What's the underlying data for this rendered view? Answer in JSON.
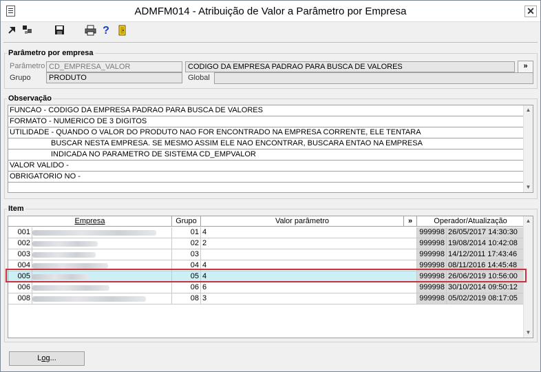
{
  "window": {
    "title": "ADMFM014 - Atribuição de Valor a Parâmetro por Empresa",
    "close_label": "✕"
  },
  "toolbar": {
    "icons": [
      "arrow-icon",
      "arrange-icon",
      "save-icon",
      "print-icon",
      "help-icon",
      "exit-icon"
    ]
  },
  "parametro": {
    "legend": "Parâmetro por empresa",
    "parametro_label": "Parâmetro",
    "parametro_value": "CD_EMPRESA_VALOR",
    "descricao_value": "CODIGO DA EMPRESA PADRAO PARA BUSCA DE VALORES",
    "expand_label": "»",
    "grupo_label": "Grupo",
    "grupo_value": "PRODUTO",
    "global_label": "Global",
    "global_value": ""
  },
  "observacao": {
    "legend": "Observação",
    "lines": [
      "FUNCAO - CODIGO DA EMPRESA PADRAO PARA BUSCA DE VALORES",
      "FORMATO - NUMERICO DE 3 DIGITOS",
      "UTILIDADE - QUANDO O VALOR DO PRODUTO NAO FOR ENCONTRADO NA EMPRESA CORRENTE, ELE TENTARA",
      "BUSCAR NESTA EMPRESA. SE MESMO ASSIM ELE NAO ENCONTRAR, BUSCARA ENTAO NA EMPRESA",
      "INDICADA NO PARAMETRO DE SISTEMA CD_EMPVALOR",
      "VALOR VALIDO -",
      "OBRIGATORIO NO -"
    ]
  },
  "item": {
    "legend": "Item",
    "columns": {
      "empresa": "Empresa",
      "grupo": "Grupo",
      "valor": "Valor parâmetro",
      "more": "»",
      "operador": "Operador/Atualização"
    },
    "rows": [
      {
        "code": "001",
        "grupo": "01",
        "valor": "4",
        "operador": "999998",
        "data": "26/05/2017 14:30:30"
      },
      {
        "code": "002",
        "grupo": "02",
        "valor": "2",
        "operador": "999998",
        "data": "19/08/2014 10:42:08"
      },
      {
        "code": "003",
        "grupo": "03",
        "valor": "",
        "operador": "999998",
        "data": "14/12/2011 17:43:46"
      },
      {
        "code": "004",
        "grupo": "04",
        "valor": "4",
        "operador": "999998",
        "data": "08/11/2016 14:45:48"
      },
      {
        "code": "005",
        "grupo": "05",
        "valor": "4",
        "operador": "999998",
        "data": "26/06/2019 10:56:00"
      },
      {
        "code": "006",
        "grupo": "06",
        "valor": "6",
        "operador": "999998",
        "data": "30/10/2014 09:50:12"
      },
      {
        "code": "008",
        "grupo": "08",
        "valor": "3",
        "operador": "999998",
        "data": "05/02/2019 08:17:05"
      }
    ]
  },
  "buttons": {
    "log_prefix": "L",
    "log_underlined": "o",
    "log_suffix": "g..."
  },
  "colors": {
    "selected_row": "#cdeff6",
    "highlight_border": "#c8323a"
  }
}
